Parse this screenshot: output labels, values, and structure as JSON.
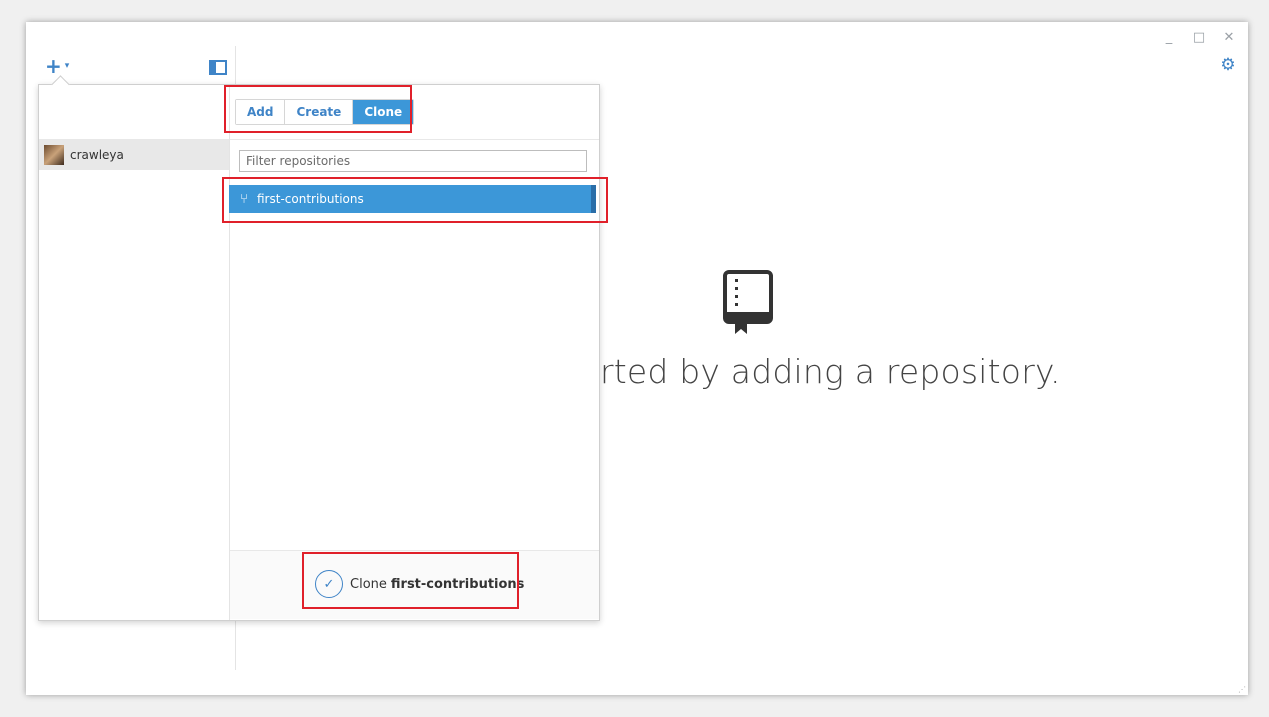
{
  "window": {
    "controls": {
      "minimize": "_",
      "maximize": "□",
      "close": "✕"
    }
  },
  "sidebar": {
    "add_icon": "plus-icon",
    "add_caret": "▾"
  },
  "empty_state": {
    "message": "rted by adding a repository."
  },
  "popover": {
    "tabs": [
      {
        "label": "Add",
        "active": false
      },
      {
        "label": "Create",
        "active": false
      },
      {
        "label": "Clone",
        "active": true
      }
    ],
    "account": {
      "name": "crawleya"
    },
    "filter": {
      "placeholder": "Filter repositories",
      "value": ""
    },
    "repositories": [
      {
        "name": "first-contributions",
        "selected": true
      }
    ],
    "footer": {
      "action_prefix": "Clone",
      "action_target": "first-contributions"
    }
  },
  "colors": {
    "accent": "#3c97d8",
    "link": "#3f84c7",
    "highlight_box": "#e0202a"
  }
}
